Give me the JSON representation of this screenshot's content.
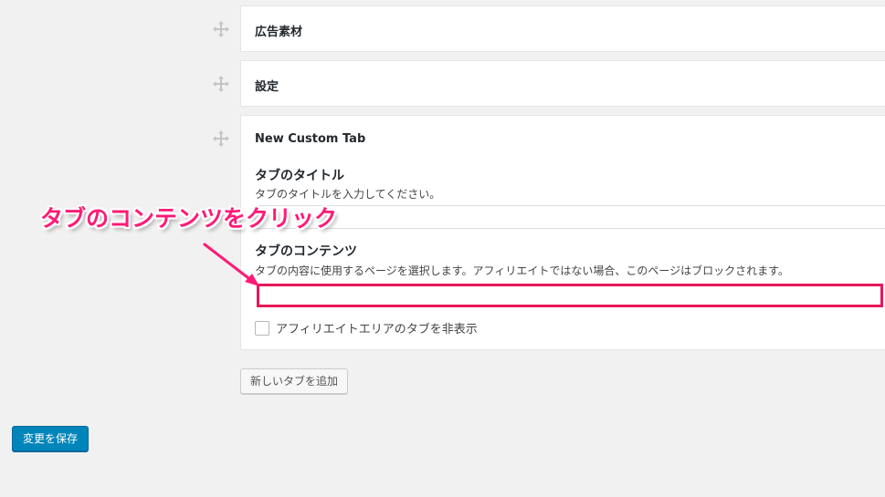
{
  "panels": [
    {
      "title": "広告素材"
    },
    {
      "title": "設定"
    },
    {
      "title": "New Custom Tab"
    }
  ],
  "custom_tab": {
    "title_field": {
      "label": "タブのタイトル",
      "description": "タブのタイトルを入力してください。",
      "value": ""
    },
    "content_field": {
      "label": "タブのコンテンツ",
      "description": "タブの内容に使用するページを選択します。アフィリエイトではない場合、このページはブロックされます。",
      "selected": ""
    },
    "hide_checkbox": {
      "label": "アフィリエイトエリアのタブを非表示",
      "checked": false
    }
  },
  "buttons": {
    "add_tab": "新しいタブを追加",
    "save": "変更を保存"
  },
  "annotation": {
    "text": "タブのコンテンツをクリック",
    "color": "#ff1a75"
  },
  "colors": {
    "primary_button": "#0085ba",
    "highlight_border": "#e8185a"
  },
  "icons": {
    "drag_handle": "move-icon"
  }
}
